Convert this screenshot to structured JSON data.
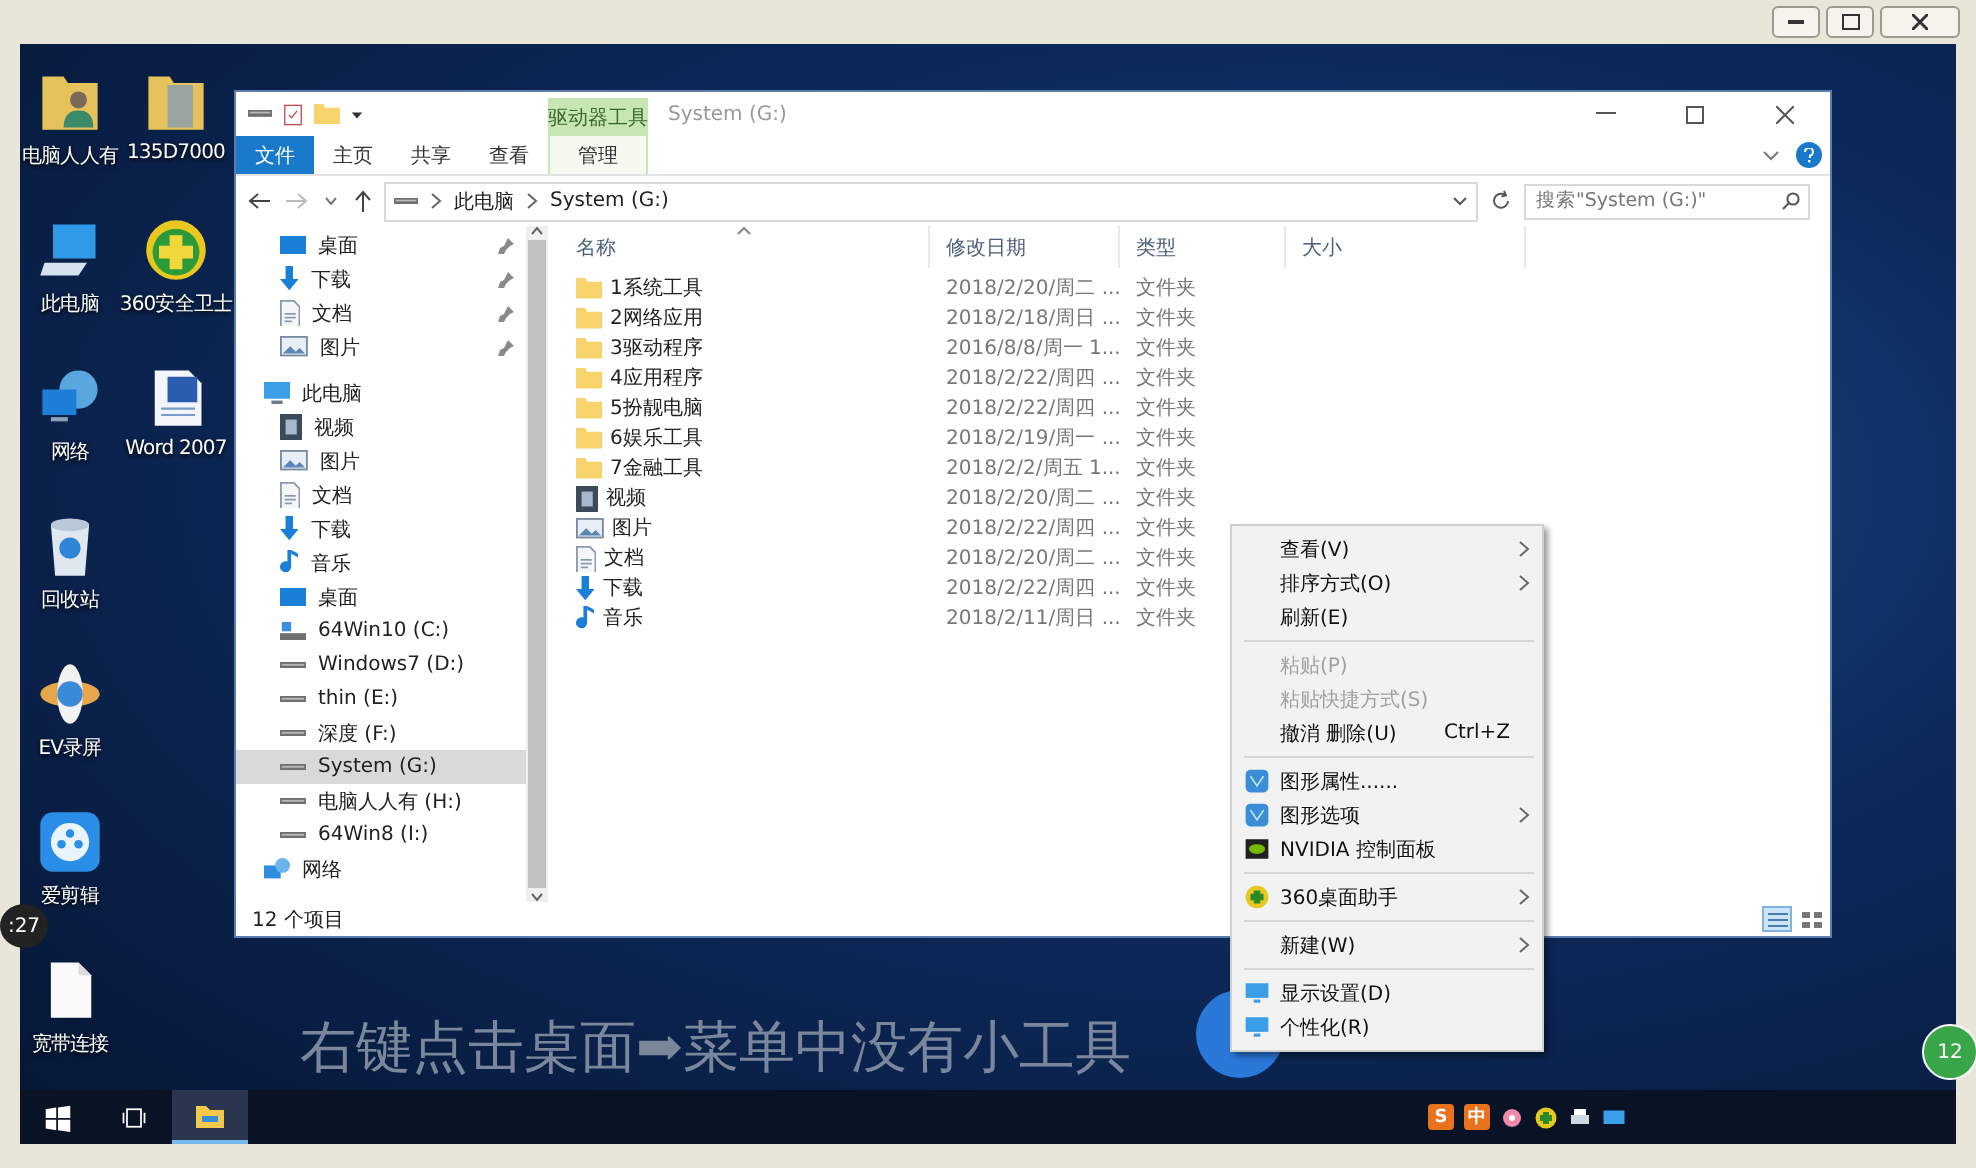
{
  "host_frame": {
    "timer_badge": ":27",
    "side_badge": "12"
  },
  "desktop_icons": [
    {
      "label": "电脑人人有",
      "kind": "folder-person"
    },
    {
      "label": "此电脑",
      "kind": "computer"
    },
    {
      "label": "网络",
      "kind": "network"
    },
    {
      "label": "回收站",
      "kind": "recycle"
    },
    {
      "label": "EV录屏",
      "kind": "flower"
    },
    {
      "label": "爱剪辑",
      "kind": "video-app"
    },
    {
      "label": "宽带连接",
      "kind": "file"
    },
    {
      "label": "135D7000",
      "kind": "folder"
    },
    {
      "label": "360安全卫士",
      "kind": "shield"
    },
    {
      "label": "Word 2007",
      "kind": "document"
    }
  ],
  "explorer": {
    "title": "System (G:)",
    "context_tab_group": "驱动器工具",
    "file_tab": "文件",
    "tabs": [
      {
        "label": "主页",
        "selected": false,
        "kind": "normal"
      },
      {
        "label": "共享",
        "selected": false,
        "kind": "normal"
      },
      {
        "label": "查看",
        "selected": false,
        "kind": "normal"
      },
      {
        "label": "管理",
        "selected": false,
        "kind": "context"
      }
    ],
    "address": [
      "此电脑",
      "System (G:)"
    ],
    "search": {
      "placeholder": "搜索\"System (G:)\""
    },
    "nav": [
      {
        "label": "桌面",
        "kind": "desktop",
        "pinned": true,
        "selected": false
      },
      {
        "label": "下载",
        "kind": "download",
        "pinned": true,
        "selected": false
      },
      {
        "label": "文档",
        "kind": "doc",
        "pinned": true,
        "selected": false
      },
      {
        "label": "图片",
        "kind": "picture",
        "pinned": true,
        "selected": false
      },
      {
        "label": "此电脑",
        "kind": "pc",
        "selected": false,
        "children": [
          {
            "label": "视频",
            "kind": "video",
            "selected": false
          },
          {
            "label": "图片",
            "kind": "picture",
            "selected": false
          },
          {
            "label": "文档",
            "kind": "doc",
            "selected": false
          },
          {
            "label": "下载",
            "kind": "download",
            "selected": false
          },
          {
            "label": "音乐",
            "kind": "music",
            "selected": false
          },
          {
            "label": "桌面",
            "kind": "desktop",
            "selected": false
          },
          {
            "label": "64Win10 (C:)",
            "kind": "sysdrive",
            "selected": false
          },
          {
            "label": "Windows7 (D:)",
            "kind": "drive",
            "selected": false
          },
          {
            "label": "thin (E:)",
            "kind": "drive",
            "selected": false
          },
          {
            "label": "深度 (F:)",
            "kind": "drive",
            "selected": false
          },
          {
            "label": "System (G:)",
            "kind": "drive",
            "selected": true
          },
          {
            "label": "电脑人人有 (H:)",
            "kind": "drive",
            "selected": false
          },
          {
            "label": "64Win8 (I:)",
            "kind": "drive",
            "selected": false
          }
        ]
      },
      {
        "label": "网络",
        "kind": "network",
        "selected": false
      }
    ],
    "columns": [
      {
        "label": "名称",
        "sorted": true
      },
      {
        "label": "修改日期"
      },
      {
        "label": "类型"
      },
      {
        "label": "大小"
      }
    ],
    "rows": [
      {
        "name": "1系统工具",
        "date": "2018/2/20/周二 ...",
        "type": "文件夹",
        "kind": "folder"
      },
      {
        "name": "2网络应用",
        "date": "2018/2/18/周日 ...",
        "type": "文件夹",
        "kind": "folder"
      },
      {
        "name": "3驱动程序",
        "date": "2016/8/8/周一 1...",
        "type": "文件夹",
        "kind": "folder"
      },
      {
        "name": "4应用程序",
        "date": "2018/2/22/周四 ...",
        "type": "文件夹",
        "kind": "folder"
      },
      {
        "name": "5扮靓电脑",
        "date": "2018/2/22/周四 ...",
        "type": "文件夹",
        "kind": "folder"
      },
      {
        "name": "6娱乐工具",
        "date": "2018/2/19/周一 ...",
        "type": "文件夹",
        "kind": "folder"
      },
      {
        "name": "7金融工具",
        "date": "2018/2/2/周五 1...",
        "type": "文件夹",
        "kind": "folder"
      },
      {
        "name": "视频",
        "date": "2018/2/20/周二 ...",
        "type": "文件夹",
        "kind": "video"
      },
      {
        "name": "图片",
        "date": "2018/2/22/周四 ...",
        "type": "文件夹",
        "kind": "picture"
      },
      {
        "name": "文档",
        "date": "2018/2/20/周二 ...",
        "type": "文件夹",
        "kind": "doc"
      },
      {
        "name": "下载",
        "date": "2018/2/22/周四 ...",
        "type": "文件夹",
        "kind": "download"
      },
      {
        "name": "音乐",
        "date": "2018/2/11/周日 ...",
        "type": "文件夹",
        "kind": "music"
      }
    ],
    "status": "12 个项目",
    "views": [
      {
        "kind": "details",
        "selected": true
      },
      {
        "kind": "tiles",
        "selected": false
      }
    ]
  },
  "context_menu": [
    {
      "kind": "plain",
      "label": "查看(V)",
      "submenu": true,
      "disabled": false
    },
    {
      "kind": "plain",
      "label": "排序方式(O)",
      "submenu": true,
      "disabled": false
    },
    {
      "kind": "plain",
      "label": "刷新(E)",
      "submenu": false,
      "disabled": false
    },
    {
      "kind": "separator"
    },
    {
      "kind": "plain",
      "label": "粘贴(P)",
      "submenu": false,
      "disabled": true
    },
    {
      "kind": "plain",
      "label": "粘贴快捷方式(S)",
      "submenu": false,
      "disabled": true
    },
    {
      "kind": "plain",
      "label": "撤消 删除(U)",
      "shortcut": "Ctrl+Z",
      "submenu": false,
      "disabled": false
    },
    {
      "kind": "separator"
    },
    {
      "kind": "graphics",
      "label": "图形属性......",
      "submenu": false,
      "disabled": false
    },
    {
      "kind": "graphics",
      "label": "图形选项",
      "submenu": true,
      "disabled": false
    },
    {
      "kind": "gpu",
      "label": "NVIDIA 控制面板",
      "submenu": false,
      "disabled": false
    },
    {
      "kind": "separator"
    },
    {
      "kind": "plus-circle",
      "label": "360桌面助手",
      "submenu": true,
      "disabled": false
    },
    {
      "kind": "separator"
    },
    {
      "kind": "plain",
      "label": "新建(W)",
      "submenu": true,
      "disabled": false
    },
    {
      "kind": "separator"
    },
    {
      "kind": "monitor",
      "label": "显示设置(D)",
      "submenu": false,
      "disabled": false
    },
    {
      "kind": "monitor",
      "label": "个性化(R)",
      "submenu": false,
      "disabled": false
    }
  ],
  "caption": "右键点击桌面➡菜单中没有小工具",
  "taskbar": {
    "apps": [
      {
        "kind": "start",
        "active": false
      },
      {
        "kind": "task-view",
        "active": false
      },
      {
        "kind": "explorer",
        "active": true
      }
    ],
    "tray": [
      {
        "kind": "glyph",
        "glyph": "S",
        "color": "#e8731c"
      },
      {
        "kind": "glyph",
        "glyph": "中",
        "color": "#e8731c"
      },
      {
        "kind": "flower"
      },
      {
        "kind": "plus-circle"
      },
      {
        "kind": "printer"
      },
      {
        "kind": "network"
      }
    ]
  }
}
